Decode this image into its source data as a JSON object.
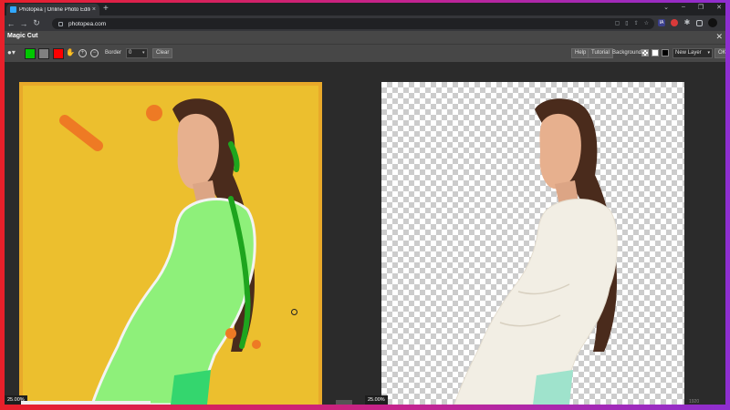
{
  "browser": {
    "tab_title": "Photopea | Online Photo Editor",
    "tab_close": "×",
    "new_tab": "+",
    "url": "photopea.com",
    "window_controls": {
      "minimize": "–",
      "restore": "❐",
      "close": "✕",
      "tab_search": "⌄"
    },
    "nav": {
      "back": "←",
      "forward": "→",
      "reload": "↻"
    },
    "extensions": {
      "ia": "IA",
      "profile": "Profile"
    },
    "menu": "⋮"
  },
  "dialog": {
    "title": "Magic Cut",
    "close": "✕"
  },
  "toolbar": {
    "brush_icon": "brush-dropdown",
    "swatches": [
      {
        "name": "foreground",
        "color": "#00c800"
      },
      {
        "name": "unknown",
        "color": "#808080"
      },
      {
        "name": "background",
        "color": "#ff0000"
      }
    ],
    "plus": "+",
    "minus": "−",
    "border_label": "Border",
    "border_value": "0",
    "clear_label": "Clear",
    "help_label": "Help",
    "tutorial_label": "Tutorial",
    "background_label": "Background:",
    "layer_select_value": "New Layer",
    "ok_label": "OK"
  },
  "workspace": {
    "left_zoom": "25.00%",
    "right_zoom": "25.00%",
    "page_indicator": "1920",
    "colors": {
      "left_bg": "#ecbf2e",
      "left_border": "#e8a92a",
      "mask_green": "#8ef07a",
      "dark_green_stroke": "#1ea51e",
      "orange_stroke": "#ee7a24"
    }
  }
}
